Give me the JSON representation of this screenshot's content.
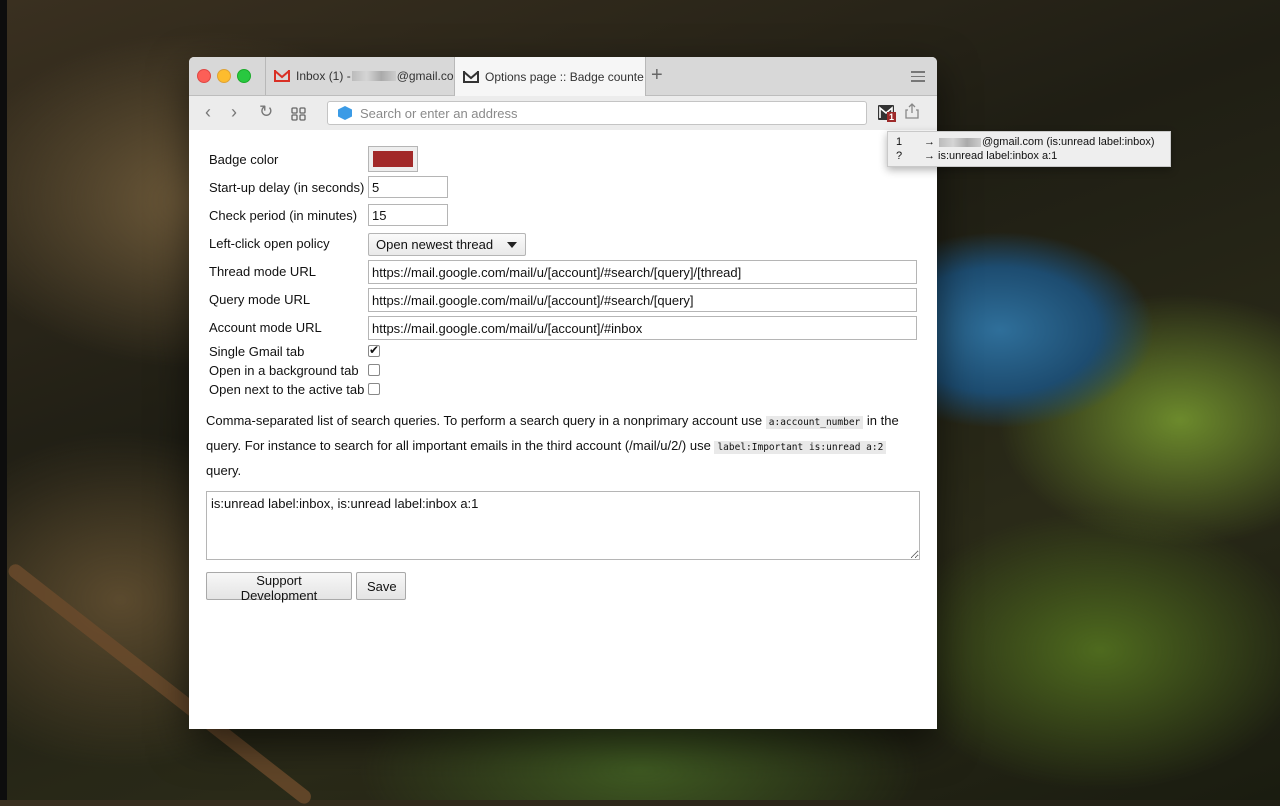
{
  "browser": {
    "tabs": [
      {
        "label_prefix": "Inbox (1) - ",
        "label_suffix": "@gmail.co",
        "icon": "gmail-icon"
      },
      {
        "label": "Options page :: Badge counte",
        "icon": "gmail-dark-icon"
      }
    ],
    "new_tab_symbol": "+",
    "address_placeholder": "Search or enter an address"
  },
  "popup": {
    "rows": [
      {
        "number": "1",
        "arrow": "→",
        "text_suffix": "@gmail.com (is:unread label:inbox)"
      },
      {
        "number": "?",
        "arrow": "→",
        "text": "is:unread label:inbox a:1"
      }
    ]
  },
  "options": {
    "badge_color_label": "Badge color",
    "badge_color": "#a22929",
    "startup_delay_label": "Start-up delay (in seconds)",
    "startup_delay_value": "5",
    "check_period_label": "Check period (in minutes)",
    "check_period_value": "15",
    "left_click_label": "Left-click open policy",
    "left_click_value": "Open newest thread",
    "thread_url_label": "Thread mode URL",
    "thread_url_value": "https://mail.google.com/mail/u/[account]/#search/[query]/[thread]",
    "query_url_label": "Query mode URL",
    "query_url_value": "https://mail.google.com/mail/u/[account]/#search/[query]",
    "account_url_label": "Account mode URL",
    "account_url_value": "https://mail.google.com/mail/u/[account]/#inbox",
    "single_tab_label": "Single Gmail tab",
    "single_tab_checked": true,
    "background_tab_label": "Open in a background tab",
    "background_tab_checked": false,
    "next_tab_label": "Open next to the active tab",
    "next_tab_checked": false,
    "desc_part1": "Comma-separated list of search queries. To perform a search query in a nonprimary account use ",
    "desc_code1": "a:account_number",
    "desc_part2": " in the query. For instance to search for all important emails in the third account (/mail/u/2/) use ",
    "desc_code2": "label:Important is:unread a:2",
    "desc_part3": " query.",
    "queries_value": "is:unread label:inbox, is:unread label:inbox a:1",
    "support_button": "Support Development",
    "save_button": "Save"
  }
}
